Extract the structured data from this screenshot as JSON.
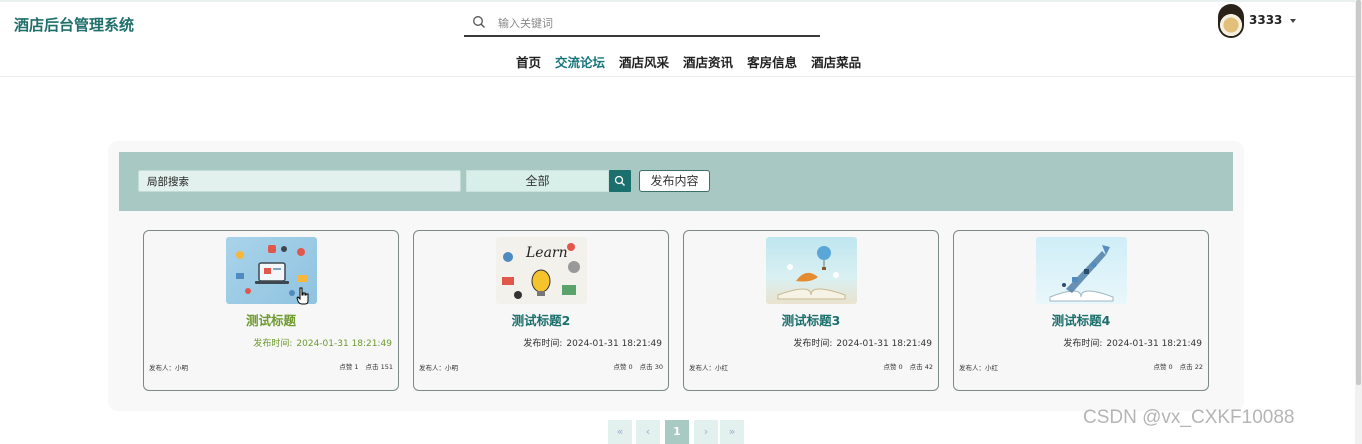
{
  "header": {
    "brand": "酒店后台管理系统",
    "search_placeholder": "输入关键词",
    "username": "3333",
    "nav": [
      "首页",
      "交流论坛",
      "酒店风采",
      "酒店资讯",
      "客房信息",
      "酒店菜品"
    ],
    "active_nav": "交流论坛"
  },
  "filter": {
    "local_search_value": "局部搜索",
    "type_value": "全部",
    "publish_label": "发布内容"
  },
  "cards": [
    {
      "title": "测试标题",
      "time_label": "发布时间:",
      "time": "2024-01-31 18:21:49",
      "author": "发布人：小明",
      "likes": "点赞 1",
      "clicks": "点击 151"
    },
    {
      "title": "测试标题2",
      "time_label": "发布时间:",
      "time": "2024-01-31 18:21:49",
      "author": "发布人：小明",
      "likes": "点赞 0",
      "clicks": "点击 30"
    },
    {
      "title": "测试标题3",
      "time_label": "发布时间:",
      "time": "2024-01-31 18:21:49",
      "author": "发布人：小红",
      "likes": "点赞 0",
      "clicks": "点击 42"
    },
    {
      "title": "测试标题4",
      "time_label": "发布时间:",
      "time": "2024-01-31 18:21:49",
      "author": "发布人：小红",
      "likes": "点赞 0",
      "clicks": "点击 22"
    }
  ],
  "pagination": {
    "first": "«",
    "prev": "‹",
    "current": "1",
    "next": "›",
    "last": "»"
  },
  "watermark": "CSDN @vx_CXKF10088",
  "colors": {
    "accent": "#1b6f6c",
    "filterbar": "#a7c8c3",
    "hover_title": "#6e9a2f"
  }
}
